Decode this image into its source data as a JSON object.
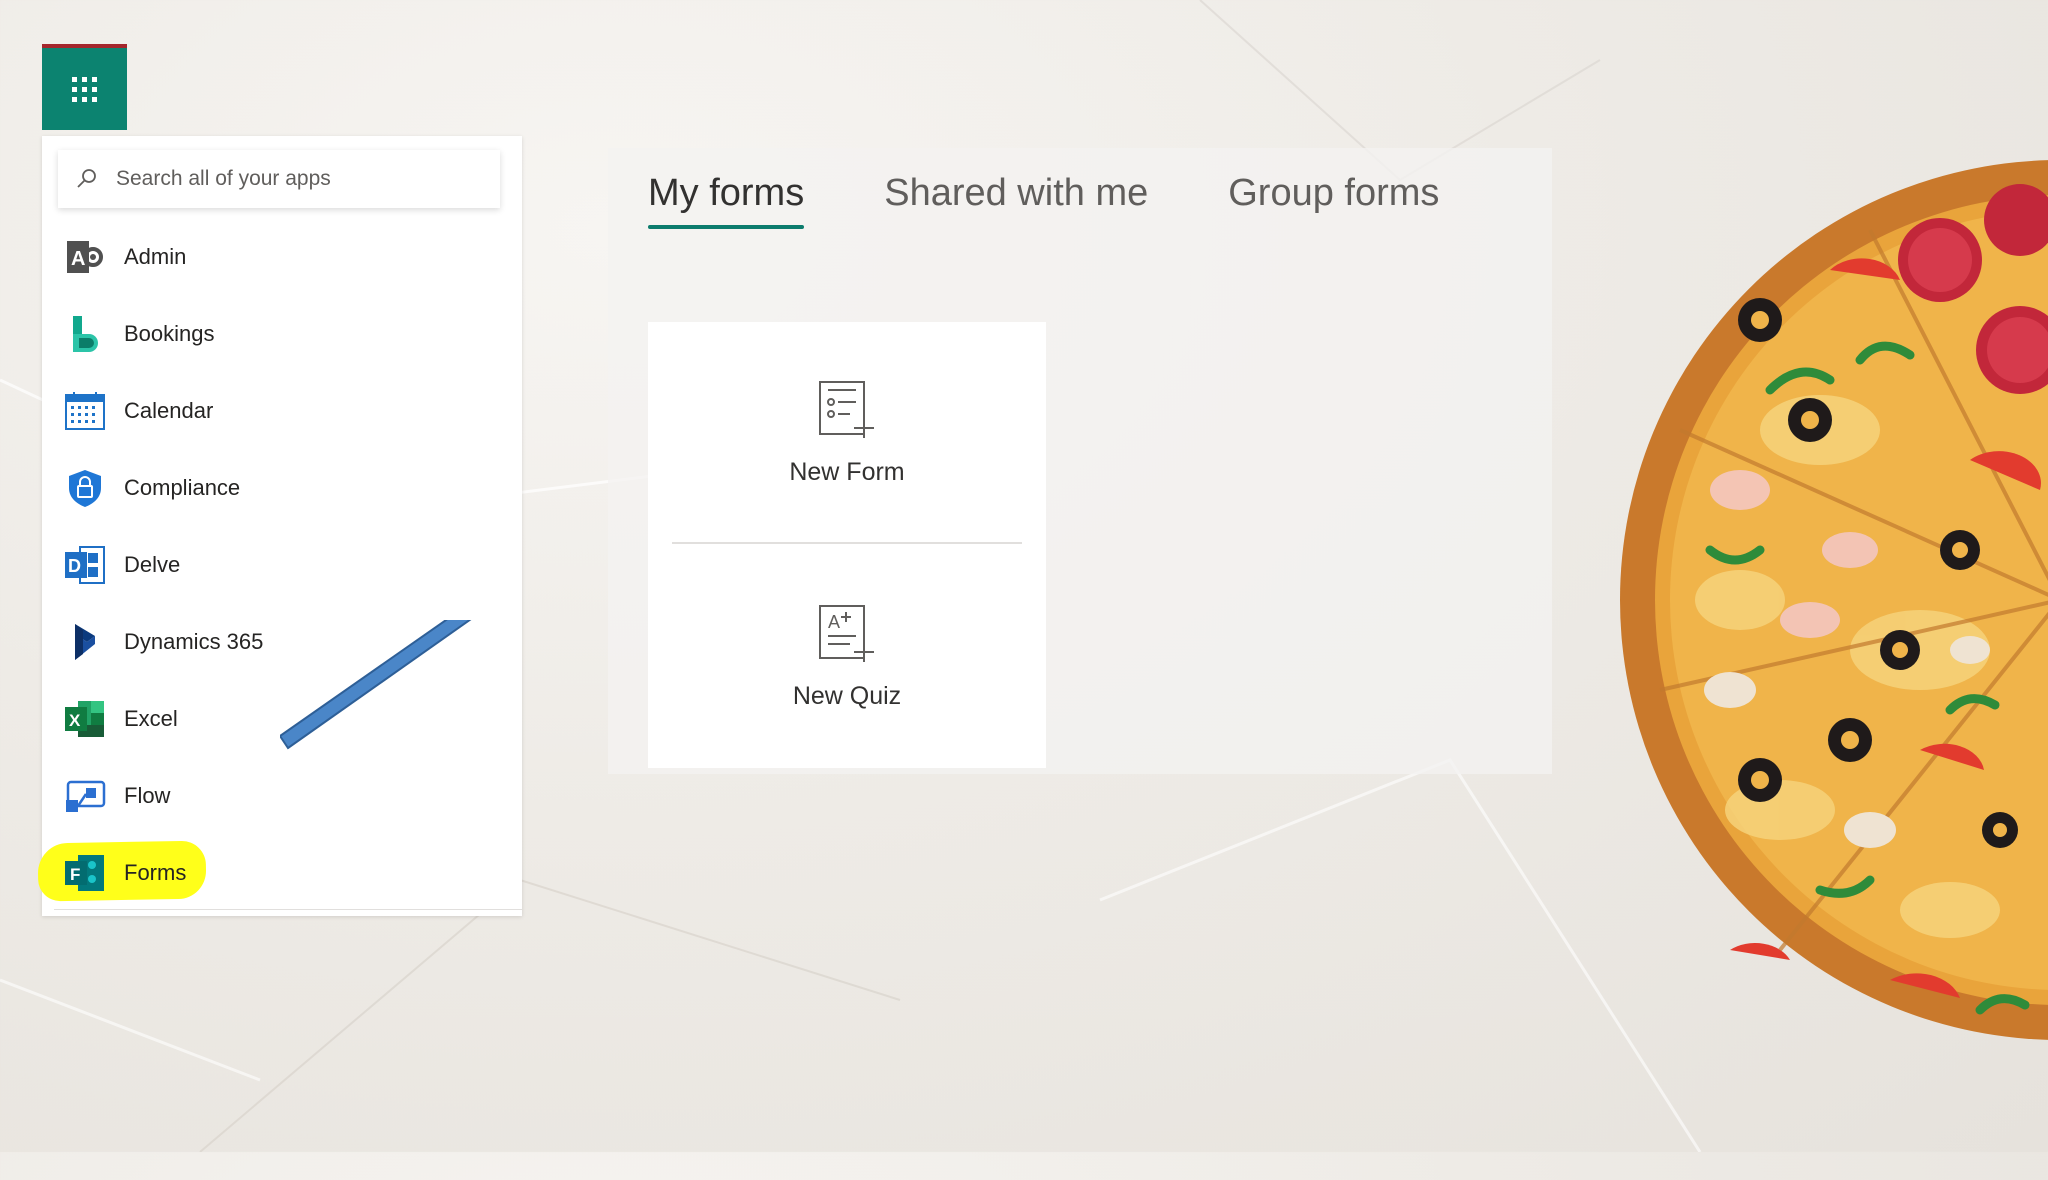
{
  "launcher": {
    "search_placeholder": "Search all of your apps",
    "apps": [
      {
        "label": "Admin",
        "icon": "admin-icon"
      },
      {
        "label": "Bookings",
        "icon": "bookings-icon"
      },
      {
        "label": "Calendar",
        "icon": "calendar-icon"
      },
      {
        "label": "Compliance",
        "icon": "compliance-icon"
      },
      {
        "label": "Delve",
        "icon": "delve-icon"
      },
      {
        "label": "Dynamics 365",
        "icon": "dynamics-365-icon"
      },
      {
        "label": "Excel",
        "icon": "excel-icon"
      },
      {
        "label": "Flow",
        "icon": "flow-icon"
      },
      {
        "label": "Forms",
        "icon": "forms-icon",
        "highlighted": true
      }
    ]
  },
  "forms": {
    "tabs": [
      {
        "label": "My forms",
        "active": true
      },
      {
        "label": "Shared with me",
        "active": false
      },
      {
        "label": "Group forms",
        "active": false
      }
    ],
    "new_form_label": "New Form",
    "new_quiz_label": "New Quiz"
  },
  "colors": {
    "waffle": "#0c8370",
    "highlight": "#ffff1a",
    "arrow": "#4a86c8",
    "tab_underline": "#0c7c6d"
  }
}
